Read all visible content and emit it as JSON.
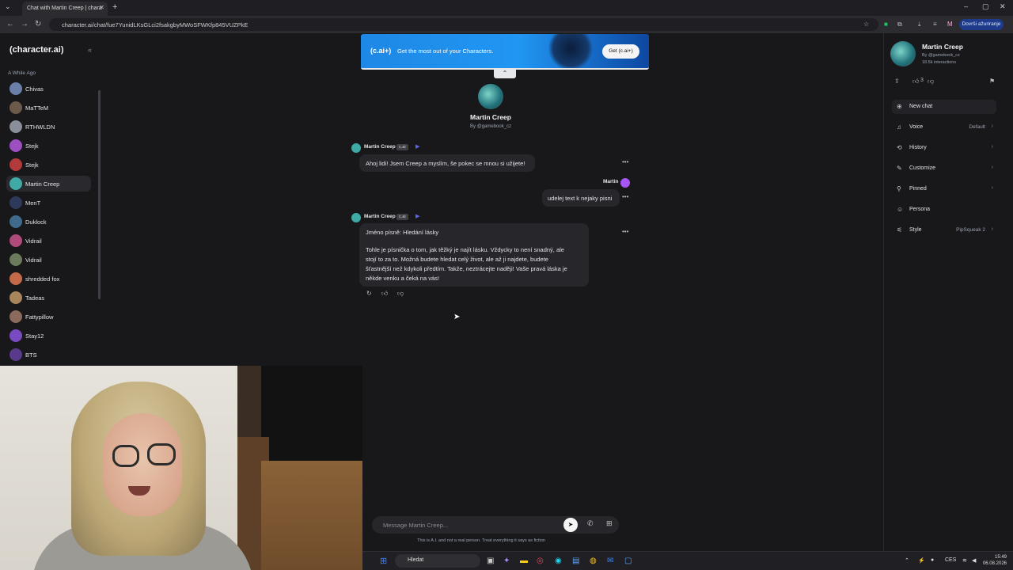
{
  "browser": {
    "tab_title": "Chat with Martin Creep | chara",
    "url": "character.ai/chat/fue7YunidLKsGLci2fsakgbyMWoSFWKfp845VUZPkE",
    "update_button": "Dovrši ažuriranje",
    "profile_initial": "M"
  },
  "sidebar": {
    "logo": "(character.ai)",
    "section_label": "A While Ago",
    "items": [
      {
        "name": "Chivas",
        "color": "#6b7fa8"
      },
      {
        "name": "MaTTeM",
        "color": "#6b5a4a"
      },
      {
        "name": "RTHWLDN",
        "color": "#8a8f99"
      },
      {
        "name": "Stejk",
        "color": "#9d4fc2"
      },
      {
        "name": "Stejk",
        "color": "#b23a3a"
      },
      {
        "name": "Martin Creep",
        "color": "#3fa9a5"
      },
      {
        "name": "MenT",
        "color": "#2d3a5a"
      },
      {
        "name": "Duklock",
        "color": "#3f6a8a"
      },
      {
        "name": "Vidrail",
        "color": "#b04a7a"
      },
      {
        "name": "Vidrail",
        "color": "#6a7a5a"
      },
      {
        "name": "shredded fox",
        "color": "#c46a4a"
      },
      {
        "name": "Tadeas",
        "color": "#a8845a"
      },
      {
        "name": "Fattypillow",
        "color": "#8a6a5a"
      },
      {
        "name": "Stay12",
        "color": "#7a4ac2"
      },
      {
        "name": "BTS",
        "color": "#5a3a8a"
      }
    ]
  },
  "banner": {
    "brand": "(c.ai+)",
    "message": "Get the most out of your Characters.",
    "button": "Get (c.ai+)"
  },
  "character": {
    "name": "Martin Creep",
    "by": "By @gamebook_cz",
    "interactions": "18.5k interactions",
    "likes": "3"
  },
  "messages": {
    "badge": "c.ai",
    "bot_name": "Martin Creep",
    "user_name": "Martin",
    "m1": "Ahoj lidi! Jsem Creep a myslím, še pokec se mnou si užijete!",
    "m2": "udelej text k nejaky pisni",
    "m3_title": "Jméno písně: Hledání lásky",
    "m3_line1": "Tohle je písnička o tom, jak těžký je najít lásku. Vždycky to není snadný, ale",
    "m3_line2": "stojí to za to. Možná budete hledat celý život, ale až ji najdete, budete",
    "m3_line3": "šťastnější než kdykoli předtím. Takže, neztrácejte naději! Vaše pravá láska je",
    "m3_line4": "někde venku a čeká na vás!"
  },
  "composer": {
    "placeholder": "Message Martin Creep...",
    "disclaimer": "This is A.I. and not a real person. Treat everything it says as fiction"
  },
  "right_panel": {
    "new_chat": "New chat",
    "voice": "Voice",
    "voice_value": "Default",
    "history": "History",
    "customize": "Customize",
    "pinned": "Pinned",
    "persona": "Persona",
    "style": "Style",
    "style_value": "PipSqueak 2"
  },
  "taskbar": {
    "search": "Hledat",
    "lang": "CES",
    "time": "15:49",
    "date": "06.08.2026"
  }
}
